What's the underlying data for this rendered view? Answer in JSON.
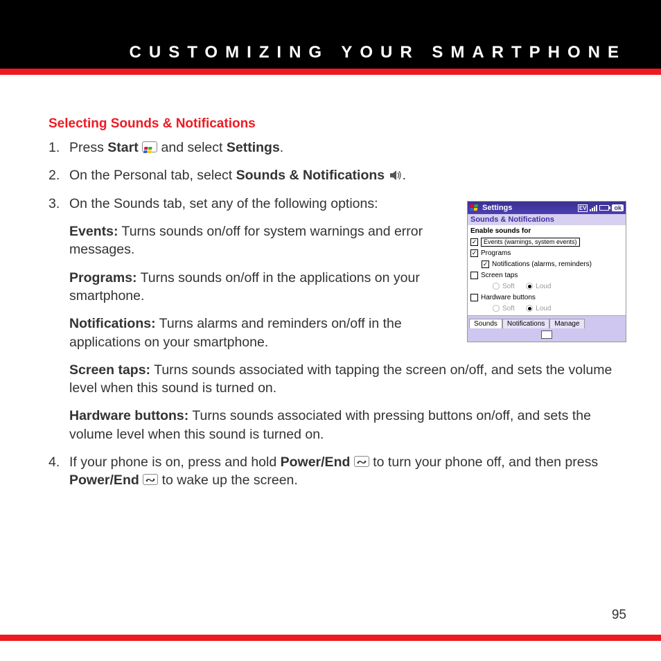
{
  "chapter_title": "CUSTOMIZING YOUR SMARTPHONE",
  "section_heading": "Selecting Sounds & Notifications",
  "page_number": "95",
  "steps": {
    "s1a": "Press ",
    "s1_start": "Start",
    "s1b": " and select ",
    "s1_settings": "Settings",
    "s1c": ".",
    "s2a": "On the Personal tab, select ",
    "s2_sn": "Sounds & Notifications",
    "s2b": " .",
    "s3a": "On the Sounds tab, set any of the following options:",
    "events_b": "Events:",
    "events_t": " Turns sounds on/off for system warnings and error messages.",
    "programs_b": "Programs:",
    "programs_t": " Turns sounds on/off in the applications on your smartphone.",
    "notif_b": "Notifications:",
    "notif_t": " Turns alarms and reminders on/off in the applications on your smartphone.",
    "taps_b": "Screen taps:",
    "taps_t": " Turns sounds associated with tapping the screen on/off, and sets the volume level when this sound is turned on.",
    "hw_b": "Hardware buttons:",
    "hw_t": " Turns sounds associated with pressing buttons on/off, and sets the volume level when this sound is turned on.",
    "s4a": "If your phone is on, press and hold ",
    "s4_pe1": "Power/End",
    "s4b": " to turn your phone off, and then press ",
    "s4_pe2": "Power/End",
    "s4c": " to wake up the screen."
  },
  "shot": {
    "title": "Settings",
    "ev": "EV",
    "ok": "ok",
    "subhead": "Sounds & Notifications",
    "group": "Enable sounds for",
    "r1": "Events (warnings, system events)",
    "r2": "Programs",
    "r3": "Notifications (alarms, reminders)",
    "r4": "Screen taps",
    "soft": "Soft",
    "loud": "Loud",
    "r5": "Hardware buttons",
    "tab1": "Sounds",
    "tab2": "Notifications",
    "tab3": "Manage"
  }
}
